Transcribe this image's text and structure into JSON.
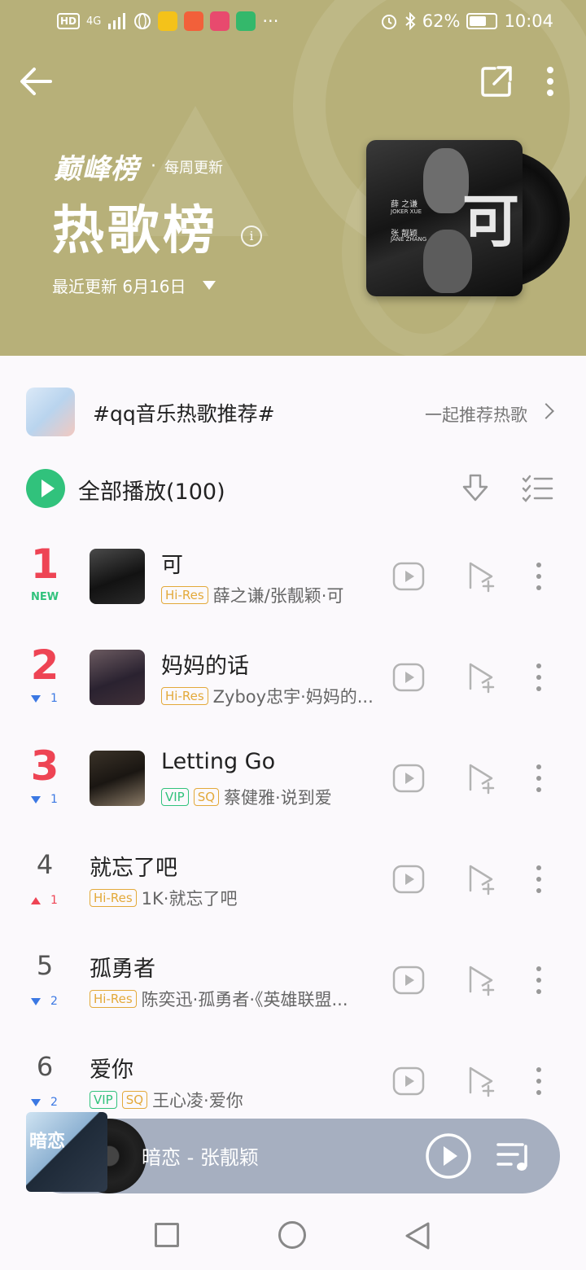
{
  "status_bar": {
    "network": "4G",
    "battery": "62%",
    "time": "10:04",
    "more": "···"
  },
  "header": {
    "brand": "巅峰榜",
    "separator": "·",
    "frequency": "每周更新",
    "title": "热歌榜",
    "info_icon": "i",
    "update_text": "最近更新 6月16日",
    "cover_char": "可",
    "cover_artist_1": "薛 之谦",
    "cover_artist_1_en": "JOKER XUE",
    "cover_artist_2": "张 靓颖",
    "cover_artist_2_en": "JANE ZHANG",
    "background_color": "#b7b079"
  },
  "hashtag": {
    "text": "#qq音乐热歌推荐#",
    "link_label": "一起推荐热歌"
  },
  "play_all": {
    "label": "全部播放(100)",
    "accent_color": "#31c27c"
  },
  "songs": [
    {
      "rank": "1",
      "badge": "NEW",
      "trend": "",
      "trend_value": "",
      "title": "可",
      "tags": [
        "Hi-Res"
      ],
      "meta": "薛之谦/张靓颖·可",
      "has_thumb": true
    },
    {
      "rank": "2",
      "badge": "",
      "trend": "down",
      "trend_value": "1",
      "title": "妈妈的话",
      "tags": [
        "Hi-Res"
      ],
      "meta": "Zyboy忠宇·妈妈的...",
      "has_thumb": true
    },
    {
      "rank": "3",
      "badge": "",
      "trend": "down",
      "trend_value": "1",
      "title": "Letting Go",
      "tags": [
        "VIP",
        "SQ"
      ],
      "meta": "蔡健雅·说到爱",
      "has_thumb": true
    },
    {
      "rank": "4",
      "badge": "",
      "trend": "up",
      "trend_value": "1",
      "title": "就忘了吧",
      "tags": [
        "Hi-Res"
      ],
      "meta": "1K·就忘了吧",
      "has_thumb": false
    },
    {
      "rank": "5",
      "badge": "",
      "trend": "down",
      "trend_value": "2",
      "title": "孤勇者",
      "tags": [
        "Hi-Res"
      ],
      "meta": "陈奕迅·孤勇者·《英雄联盟...",
      "has_thumb": false
    },
    {
      "rank": "6",
      "badge": "",
      "trend": "down",
      "trend_value": "2",
      "title": "爱你",
      "tags": [
        "VIP",
        "SQ"
      ],
      "meta": "王心凌·爱你",
      "has_thumb": false
    }
  ],
  "mini_player": {
    "now_playing": "暗恋 - 张靓颖",
    "cover_text": "暗恋"
  },
  "icons": {
    "back": "back-arrow-icon",
    "share": "share-icon",
    "more": "more-vertical-icon",
    "download": "download-icon",
    "multiselect": "multiselect-icon",
    "video": "video-play-icon",
    "add_to_playlist": "add-to-playlist-icon",
    "playlist": "playlist-icon"
  }
}
